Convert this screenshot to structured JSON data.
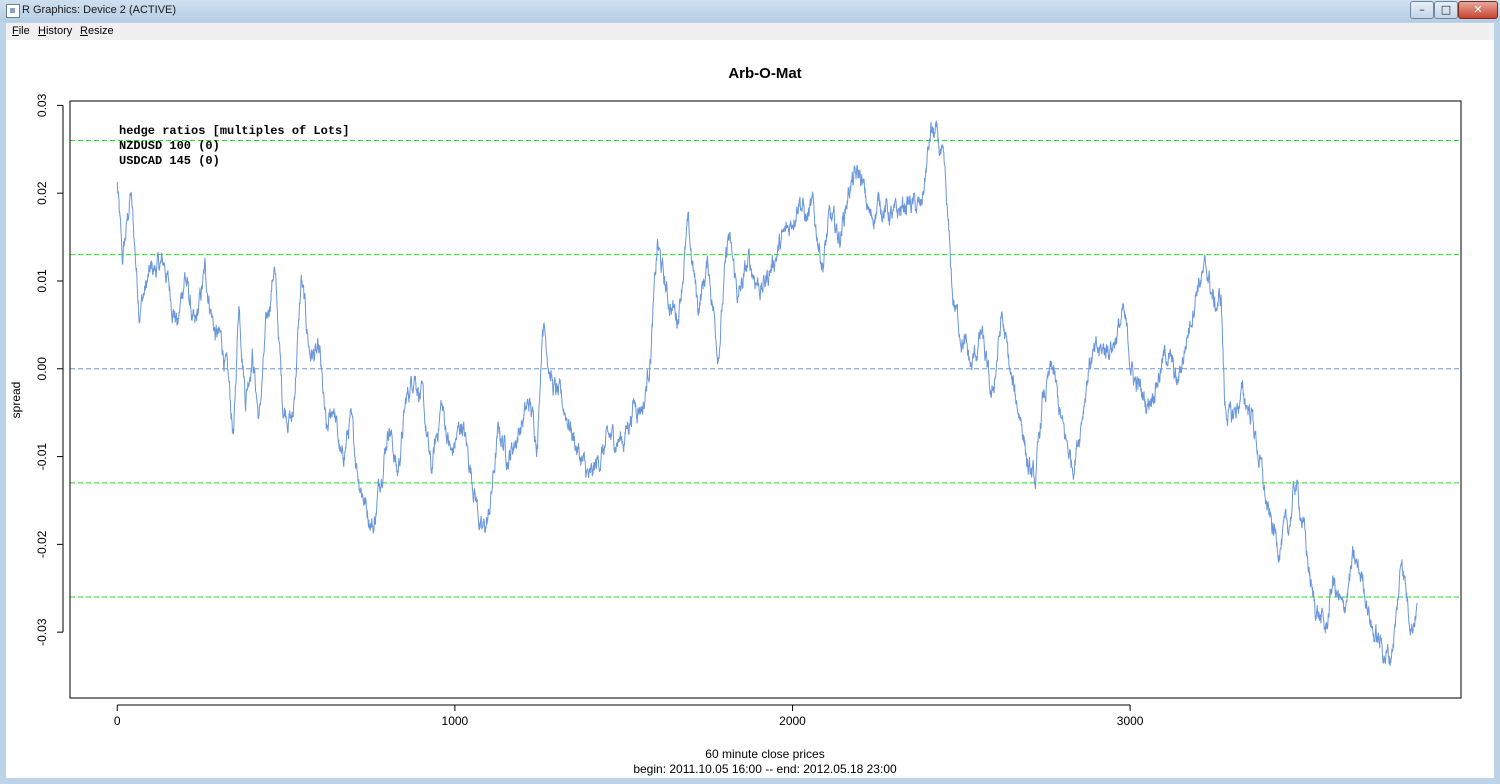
{
  "window": {
    "title": "R Graphics: Device 2 (ACTIVE)",
    "buttons": {
      "minimize": "–",
      "maximize": "□",
      "close": "✕"
    }
  },
  "menu": [
    {
      "label": "File",
      "accel": "F",
      "rest": "ile"
    },
    {
      "label": "History",
      "accel": "H",
      "rest": "istory"
    },
    {
      "label": "Resize",
      "accel": "R",
      "rest": "esize"
    }
  ],
  "chart_data": {
    "type": "line",
    "title": "Arb-O-Mat",
    "xlabel": "60 minute close prices",
    "xlabel_sub": "begin: 2011.10.05 16:00 -- end: 2012.05.18 23:00",
    "ylabel": "spread",
    "xlim": [
      -140,
      3980
    ],
    "ylim": [
      -0.0375,
      0.0305
    ],
    "x_ticks": [
      0,
      1000,
      2000,
      3000
    ],
    "x_tick_labels": [
      "0",
      "1000",
      "2000",
      "3000"
    ],
    "y_ticks": [
      -0.03,
      -0.02,
      -0.01,
      0.0,
      0.01,
      0.02,
      0.03
    ],
    "y_tick_labels": [
      "-0.03",
      "-0.02",
      "-0.01",
      "0.00",
      "0.01",
      "0.02",
      "0.03"
    ],
    "grid": false,
    "legend_lines": [
      "hedge ratios [multiples of Lots]",
      "NZDUSD 100 (0)",
      "USDCAD 145 (0)"
    ],
    "series_color": "#6a96dc",
    "hlines": [
      {
        "y": 0.026,
        "color": "#22dd22",
        "style": "dashed"
      },
      {
        "y": 0.013,
        "color": "#22dd22",
        "style": "dashed"
      },
      {
        "y": 0.0,
        "color": "#6a96dc",
        "style": "dashed"
      },
      {
        "y": -0.013,
        "color": "#22dd22",
        "style": "dashed"
      },
      {
        "y": -0.026,
        "color": "#22dd22",
        "style": "dashed"
      }
    ],
    "x_range": [
      0,
      3850
    ],
    "anchors": [
      [
        0,
        0.021
      ],
      [
        15,
        0.012
      ],
      [
        40,
        0.02
      ],
      [
        65,
        0.007
      ],
      [
        100,
        0.011
      ],
      [
        140,
        0.012
      ],
      [
        160,
        0.008
      ],
      [
        180,
        0.005
      ],
      [
        200,
        0.011
      ],
      [
        230,
        0.004
      ],
      [
        260,
        0.011
      ],
      [
        290,
        0.004
      ],
      [
        310,
        0.003
      ],
      [
        330,
        -0.002
      ],
      [
        345,
        -0.008
      ],
      [
        360,
        0.008
      ],
      [
        380,
        -0.003
      ],
      [
        400,
        0.002
      ],
      [
        420,
        -0.006
      ],
      [
        440,
        0.004
      ],
      [
        465,
        0.012
      ],
      [
        490,
        -0.004
      ],
      [
        520,
        -0.006
      ],
      [
        545,
        0.01
      ],
      [
        570,
        0.002
      ],
      [
        600,
        0.001
      ],
      [
        620,
        -0.008
      ],
      [
        640,
        -0.004
      ],
      [
        665,
        -0.011
      ],
      [
        690,
        -0.006
      ],
      [
        715,
        -0.012
      ],
      [
        740,
        -0.016
      ],
      [
        760,
        -0.018
      ],
      [
        780,
        -0.012
      ],
      [
        805,
        -0.006
      ],
      [
        830,
        -0.012
      ],
      [
        855,
        -0.004
      ],
      [
        880,
        0.0
      ],
      [
        905,
        -0.004
      ],
      [
        930,
        -0.012
      ],
      [
        960,
        -0.004
      ],
      [
        990,
        -0.01
      ],
      [
        1020,
        -0.006
      ],
      [
        1060,
        -0.014
      ],
      [
        1080,
        -0.019
      ],
      [
        1100,
        -0.017
      ],
      [
        1130,
        -0.007
      ],
      [
        1160,
        -0.01
      ],
      [
        1190,
        -0.007
      ],
      [
        1220,
        -0.004
      ],
      [
        1245,
        -0.008
      ],
      [
        1260,
        0.006
      ],
      [
        1290,
        -0.002
      ],
      [
        1330,
        -0.005
      ],
      [
        1370,
        -0.01
      ],
      [
        1400,
        -0.013
      ],
      [
        1430,
        -0.01
      ],
      [
        1460,
        -0.008
      ],
      [
        1500,
        -0.008
      ],
      [
        1530,
        -0.004
      ],
      [
        1560,
        -0.004
      ],
      [
        1580,
        0.002
      ],
      [
        1600,
        0.014
      ],
      [
        1630,
        0.008
      ],
      [
        1660,
        0.006
      ],
      [
        1690,
        0.016
      ],
      [
        1720,
        0.007
      ],
      [
        1750,
        0.012
      ],
      [
        1780,
        0.002
      ],
      [
        1810,
        0.015
      ],
      [
        1840,
        0.008
      ],
      [
        1870,
        0.012
      ],
      [
        1910,
        0.009
      ],
      [
        1950,
        0.013
      ],
      [
        1990,
        0.016
      ],
      [
        2020,
        0.02
      ],
      [
        2040,
        0.017
      ],
      [
        2060,
        0.018
      ],
      [
        2090,
        0.012
      ],
      [
        2110,
        0.017
      ],
      [
        2140,
        0.015
      ],
      [
        2170,
        0.021
      ],
      [
        2200,
        0.022
      ],
      [
        2230,
        0.017
      ],
      [
        2260,
        0.019
      ],
      [
        2300,
        0.017
      ],
      [
        2340,
        0.019
      ],
      [
        2380,
        0.018
      ],
      [
        2410,
        0.027
      ],
      [
        2430,
        0.026
      ],
      [
        2450,
        0.022
      ],
      [
        2475,
        0.008
      ],
      [
        2500,
        0.004
      ],
      [
        2530,
        0.0
      ],
      [
        2560,
        0.004
      ],
      [
        2590,
        -0.004
      ],
      [
        2620,
        0.006
      ],
      [
        2650,
        -0.002
      ],
      [
        2680,
        -0.006
      ],
      [
        2700,
        -0.012
      ],
      [
        2720,
        -0.013
      ],
      [
        2740,
        -0.004
      ],
      [
        2770,
        0.0
      ],
      [
        2800,
        -0.007
      ],
      [
        2830,
        -0.011
      ],
      [
        2850,
        -0.007
      ],
      [
        2880,
        0.001
      ],
      [
        2920,
        0.002
      ],
      [
        2950,
        0.003
      ],
      [
        2980,
        0.006
      ],
      [
        3010,
        -0.001
      ],
      [
        3050,
        -0.004
      ],
      [
        3080,
        -0.001
      ],
      [
        3110,
        0.002
      ],
      [
        3140,
        -0.002
      ],
      [
        3170,
        0.004
      ],
      [
        3200,
        0.01
      ],
      [
        3230,
        0.011
      ],
      [
        3250,
        0.007
      ],
      [
        3270,
        0.008
      ],
      [
        3280,
        -0.004
      ],
      [
        3300,
        -0.006
      ],
      [
        3330,
        -0.003
      ],
      [
        3360,
        -0.005
      ],
      [
        3390,
        -0.012
      ],
      [
        3410,
        -0.017
      ],
      [
        3440,
        -0.02
      ],
      [
        3470,
        -0.018
      ],
      [
        3490,
        -0.013
      ],
      [
        3510,
        -0.017
      ],
      [
        3540,
        -0.026
      ],
      [
        3560,
        -0.028
      ],
      [
        3580,
        -0.03
      ],
      [
        3600,
        -0.024
      ],
      [
        3630,
        -0.028
      ],
      [
        3660,
        -0.022
      ],
      [
        3690,
        -0.024
      ],
      [
        3720,
        -0.03
      ],
      [
        3750,
        -0.032
      ],
      [
        3770,
        -0.033
      ],
      [
        3790,
        -0.028
      ],
      [
        3805,
        -0.021
      ],
      [
        3820,
        -0.026
      ],
      [
        3835,
        -0.029
      ],
      [
        3850,
        -0.027
      ]
    ]
  }
}
